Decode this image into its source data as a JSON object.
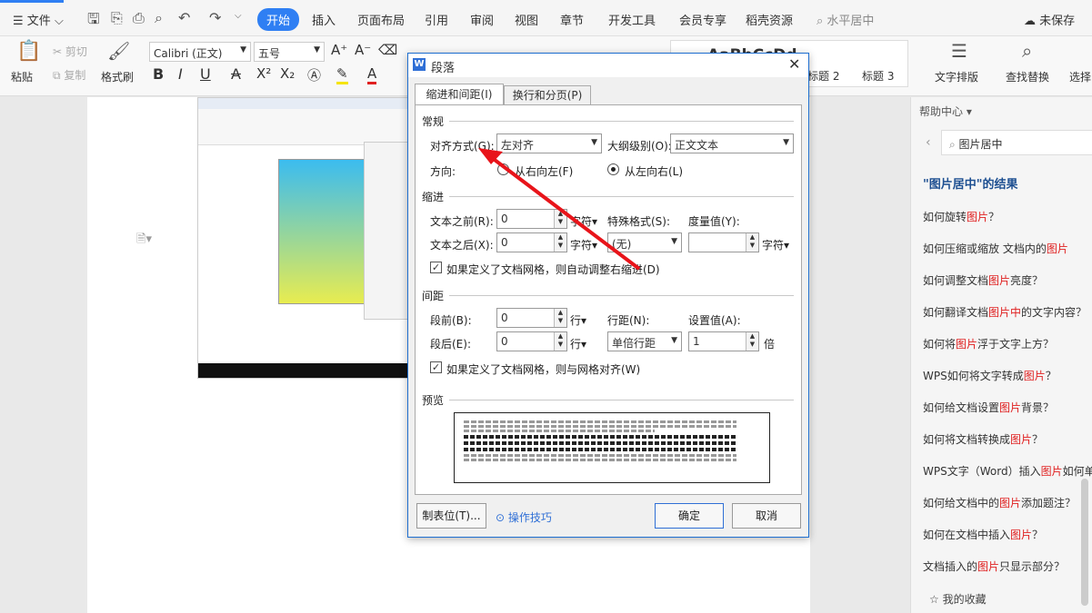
{
  "menubar": {
    "file": "文件",
    "tabs": [
      "开始",
      "插入",
      "页面布局",
      "引用",
      "审阅",
      "视图",
      "章节",
      "开发工具",
      "会员专享",
      "稻壳资源"
    ],
    "active_tab": "开始",
    "search": "水平居中",
    "save_status": "未保存"
  },
  "ribbon": {
    "paste": "粘贴",
    "cut": "剪切",
    "copy": "复制",
    "format_painter": "格式刷",
    "font": "Calibri (正文)",
    "size": "五号",
    "style_preview": "AaBbCcDd",
    "style_h2": "标题 2",
    "style_h3": "标题 3",
    "text_layout": "文字排版",
    "find_replace": "查找替换",
    "select": "选择"
  },
  "help": {
    "title": "帮助中心",
    "search_value": "图片居中",
    "results_title": "\"图片居中\"的结果",
    "links": [
      {
        "pre": "如何旋转",
        "hl": "图片",
        "post": "？"
      },
      {
        "pre": "如何压缩或缩放 文档内的",
        "hl": "图片",
        "post": ""
      },
      {
        "pre": "如何调整文档",
        "hl": "图片",
        "post": "亮度？"
      },
      {
        "pre": "如何翻译文档",
        "hl": "图片中",
        "post": "的文字内容？"
      },
      {
        "pre": "如何将",
        "hl": "图片",
        "post": "浮于文字上方？"
      },
      {
        "pre": "WPS如何将文字转成",
        "hl": "图片",
        "post": "？"
      },
      {
        "pre": "如何给文档设置",
        "hl": "图片",
        "post": "背景？"
      },
      {
        "pre": "如何将文档转换成",
        "hl": "图片",
        "post": "？"
      },
      {
        "pre": "WPS文字（Word）插入",
        "hl": "图片",
        "post": "如何单"
      },
      {
        "pre": "如何给文档中的",
        "hl": "图片",
        "post": "添加题注？"
      },
      {
        "pre": "如何在文档中插入",
        "hl": "图片",
        "post": "？"
      },
      {
        "pre": "文档插入的",
        "hl": "图片",
        "post": "只显示部分？"
      }
    ],
    "favorites": "我的收藏"
  },
  "dialog": {
    "title": "段落",
    "tab1": "缩进和间距(I)",
    "tab2": "换行和分页(P)",
    "general": "常规",
    "align_label": "对齐方式(G):",
    "align_value": "左对齐",
    "outline_label": "大纲级别(O):",
    "outline_value": "正文文本",
    "direction_label": "方向:",
    "rtl": "从右向左(F)",
    "ltr": "从左向右(L)",
    "indent": "缩进",
    "before_text": "文本之前(R):",
    "before_val": "0",
    "after_text": "文本之后(X):",
    "after_val": "0",
    "unit_char": "字符",
    "special_label": "特殊格式(S):",
    "special_value": "(无)",
    "measure_label": "度量值(Y):",
    "auto_indent": "如果定义了文档网格，则自动调整右缩进(D)",
    "spacing": "间距",
    "space_before": "段前(B):",
    "space_before_val": "0",
    "space_after": "段后(E):",
    "space_after_val": "0",
    "unit_line": "行",
    "line_spacing_label": "行距(N):",
    "line_spacing_value": "单倍行距",
    "set_value_label": "设置值(A):",
    "set_value": "1",
    "unit_times": "倍",
    "grid_align": "如果定义了文档网格，则与网格对齐(W)",
    "preview": "预览",
    "tabs_btn": "制表位(T)...",
    "tips": "操作技巧",
    "ok": "确定",
    "cancel": "取消"
  }
}
